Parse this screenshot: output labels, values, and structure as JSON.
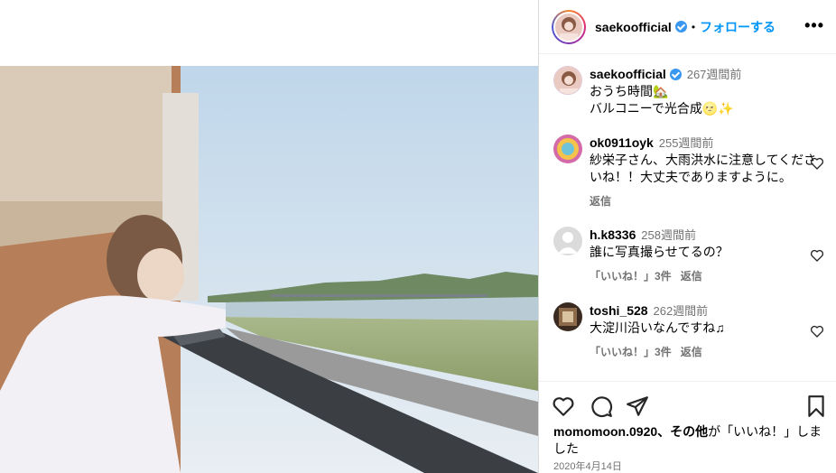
{
  "header": {
    "username": "saekoofficial",
    "separator": "•",
    "follow_label": "フォローする",
    "more_label": "•••"
  },
  "caption": {
    "username": "saekoofficial",
    "time": "267週間前",
    "line1": "おうち時間🏡",
    "line2": "バルコニーで光合成🌝✨"
  },
  "comments": [
    {
      "username": "ok0911oyk",
      "time": "255週間前",
      "text": "紗栄子さん、大雨洪水に注意してくださいね！！大丈夫でありますように。",
      "reply_label": "返信"
    },
    {
      "username": "h.k8336",
      "time": "258週間前",
      "text": "誰に写真撮らせてるの？",
      "likes_label": "「いいね！」3件",
      "reply_label": "返信"
    },
    {
      "username": "toshi_528",
      "time": "262週間前",
      "text": "大淀川沿いなんですね♫",
      "likes_label": "「いいね！」3件",
      "reply_label": "返信"
    }
  ],
  "likes_summary": {
    "user": "momomoon.0920",
    "rest": "、その他",
    "suffix": "が「いいね！」しました"
  },
  "date": "2020年4月14日",
  "icons": [
    "heart-icon",
    "comment-icon",
    "share-icon",
    "bookmark-icon",
    "verified-icon",
    "more-icon"
  ]
}
